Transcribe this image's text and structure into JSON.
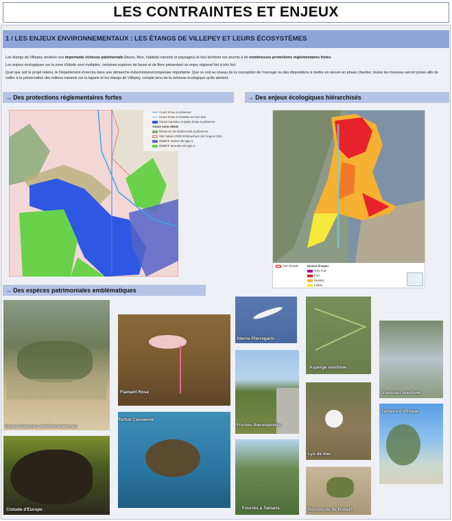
{
  "title": "LES CONTRAINTES ET ENJEUX",
  "section1": "1 / LES ENJEUX ENVIRONNEMENTAUX : LES ÉTANGS DE VILLEPEY ET LEURS ÉCOSYSTÈMES",
  "intro": {
    "p1a": "Les étangs de Villepey recèlent une ",
    "p1b": "importante richesse patrimoniale",
    "p1c": " (faune, flore, habitats naturels et paysages) et leur territoire est soumis à de ",
    "p1d": "nombreuses protections réglementaires fortes",
    "p1e": ".",
    "p2": "Les enjeux écologiques sur la zone d'étude sont multiples, certaines espèces de faune et de flore présentant un enjeu régional fort à très fort.",
    "p3": "Quel que soit le projet retenu, le Département s'inscrira dans une démarche éviter/réduire/compenser importante. Que ce soit au niveau de la conception de l'ouvrage ou des dispositions à mettre en œuvre en phase chantier, toutes les mesures seront prises afin de veiller à la préservation des milieux naturels sur la lagune et les étangs de Villepey, compte tenu de la richesse écologique qu'ils abritent."
  },
  "sub_protections": "→ Des protections réglementaires fortes",
  "sub_enjeux": "→ Des enjeux écologiques hiérarchisés",
  "sub_especes": "→ Des espèces patrimoniales emblématiques",
  "map_legend": {
    "l1": "Cours d'eau à préserver",
    "l2": "Cours d'eau à remettre en bon état",
    "l3": "Zones humides et plans d'eau à préserver",
    "heading": "Trame verte SRCE",
    "l4": "Réservoir de biodiversité à préserver",
    "l5": "Site Natura 2000 Embouchure de l'Argens (Dir)",
    "l6": "ZNIEFF marine de type II",
    "l7": "ZNIEFF terrestre de type II"
  },
  "enjeux_legend": {
    "l0": "Aire d'étude",
    "heading": "Niveau d'enjeu",
    "l1": "Très Fort",
    "l2": "Fort",
    "l3": "Modéré",
    "l4": "Faible",
    "l5": "Négligeable"
  },
  "species": {
    "dunes": "Dunes blanches méditerranéennes",
    "flamant": "Flamant Rose",
    "sterne": "Sterne Pierregarin",
    "asperge": "Asperge maritime",
    "panicaut": "Panicaut maritime",
    "friches": "Friches thermophiles",
    "tortue": "Tortue Caouanne",
    "lys": "Lys de mer",
    "tamaris": "Tamaris d'Afrique",
    "cistude": "Cistude d'Europe",
    "fourres": "Fourrés à Tamaris",
    "renoncule": "Renoncule de Robert"
  },
  "colors": {
    "header_band": "#8fa4d9",
    "sub_band": "#b4c3e6",
    "panel": "#eef0f5",
    "enjeu_tres_fort": "#e8222b",
    "enjeu_fort": "#f07a2a",
    "enjeu_modere": "#f6b132",
    "enjeu_faible": "#f5ea3b",
    "znieff_terrestre": "#6ad14b",
    "zones_humides": "#2e57e3"
  }
}
